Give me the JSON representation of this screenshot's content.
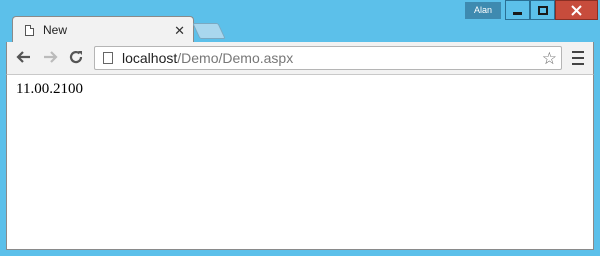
{
  "window": {
    "user_badge": "Alan",
    "colors": {
      "frame": "#5cc0ea",
      "close_button": "#c74c3c",
      "user_badge": "#3e8ab0"
    }
  },
  "tabs": [
    {
      "title": "New",
      "icon": "page-icon",
      "close_icon": "close-icon"
    }
  ],
  "toolbar": {
    "back_icon": "arrow-left-icon",
    "forward_icon": "arrow-right-icon",
    "reload_icon": "reload-icon",
    "url_host": "localhost",
    "url_path": "/Demo/Demo.aspx",
    "bookmark_icon": "star-icon",
    "menu_icon": "hamburger-menu-icon"
  },
  "page": {
    "text": "11.00.2100"
  }
}
